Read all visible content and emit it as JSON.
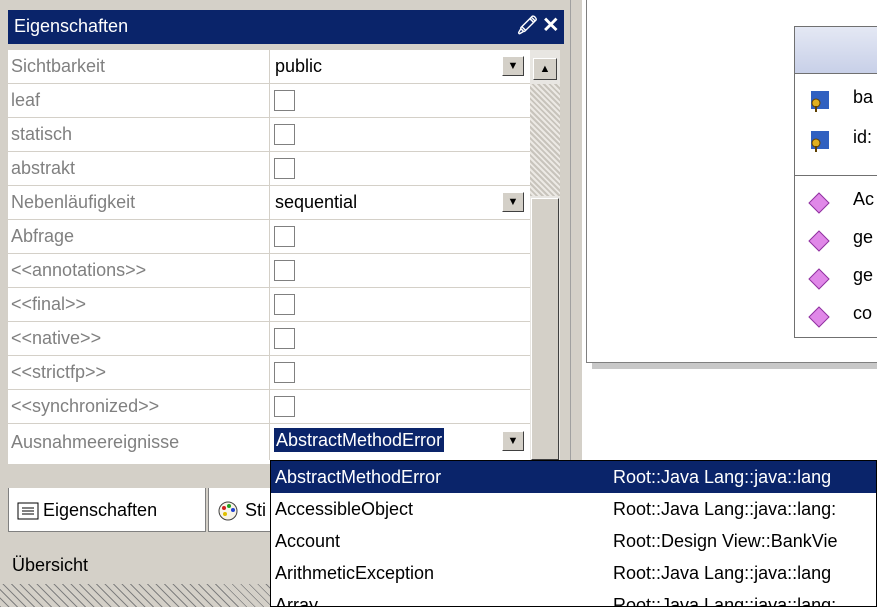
{
  "panel": {
    "title": "Eigenschaften",
    "pin_glyph": "1",
    "close_glyph": "✕"
  },
  "properties": [
    {
      "name": "Sichtbarkeit",
      "type": "dropdown",
      "value": "public"
    },
    {
      "name": "leaf",
      "type": "checkbox"
    },
    {
      "name": "statisch",
      "type": "checkbox"
    },
    {
      "name": "abstrakt",
      "type": "checkbox"
    },
    {
      "name": "Nebenläufigkeit",
      "type": "dropdown",
      "value": "sequential"
    },
    {
      "name": "Abfrage",
      "type": "checkbox"
    },
    {
      "name": "<<annotations>>",
      "type": "checkbox"
    },
    {
      "name": "<<final>>",
      "type": "checkbox"
    },
    {
      "name": "<<native>>",
      "type": "checkbox"
    },
    {
      "name": "<<strictfp>>",
      "type": "checkbox"
    },
    {
      "name": "<<synchronized>>",
      "type": "checkbox"
    },
    {
      "name": "Ausnahmeereignisse",
      "type": "dropdown",
      "value": "AbstractMethodError"
    }
  ],
  "tabs": {
    "properties_label": "Eigenschaften",
    "styles_label": "Sti"
  },
  "overview_label": "Übersicht",
  "diagram": {
    "attributes": [
      "ba",
      "id:"
    ],
    "operations": [
      "Ac",
      "ge",
      "ge",
      "co"
    ]
  },
  "dropdown_items": [
    {
      "name": "AbstractMethodError",
      "path": "Root::Java Lang::java::lang",
      "selected": true
    },
    {
      "name": "AccessibleObject",
      "path": "Root::Java Lang::java::lang:"
    },
    {
      "name": "Account",
      "path": "Root::Design View::BankVie"
    },
    {
      "name": "ArithmeticException",
      "path": "Root::Java Lang::java::lang"
    },
    {
      "name": "Array",
      "path": "Root::Java Lang::java::lang:"
    }
  ],
  "colors": {
    "title_bar": "#0a246a",
    "selection": "#0a246a",
    "panel_bg": "#d4d0c8",
    "label_grey": "#808080",
    "operation_icon": "#d060d0",
    "attribute_icon": "#3060c0"
  },
  "icons": {
    "pin": "pin-icon",
    "close": "close-icon",
    "dropdown": "dropdown-arrow-icon",
    "scroll_up": "scroll-up-arrow-icon",
    "properties_tab": "properties-list-icon",
    "styles_tab": "palette-icon",
    "attribute": "key-attribute-icon",
    "operation": "diamond-operation-icon"
  }
}
